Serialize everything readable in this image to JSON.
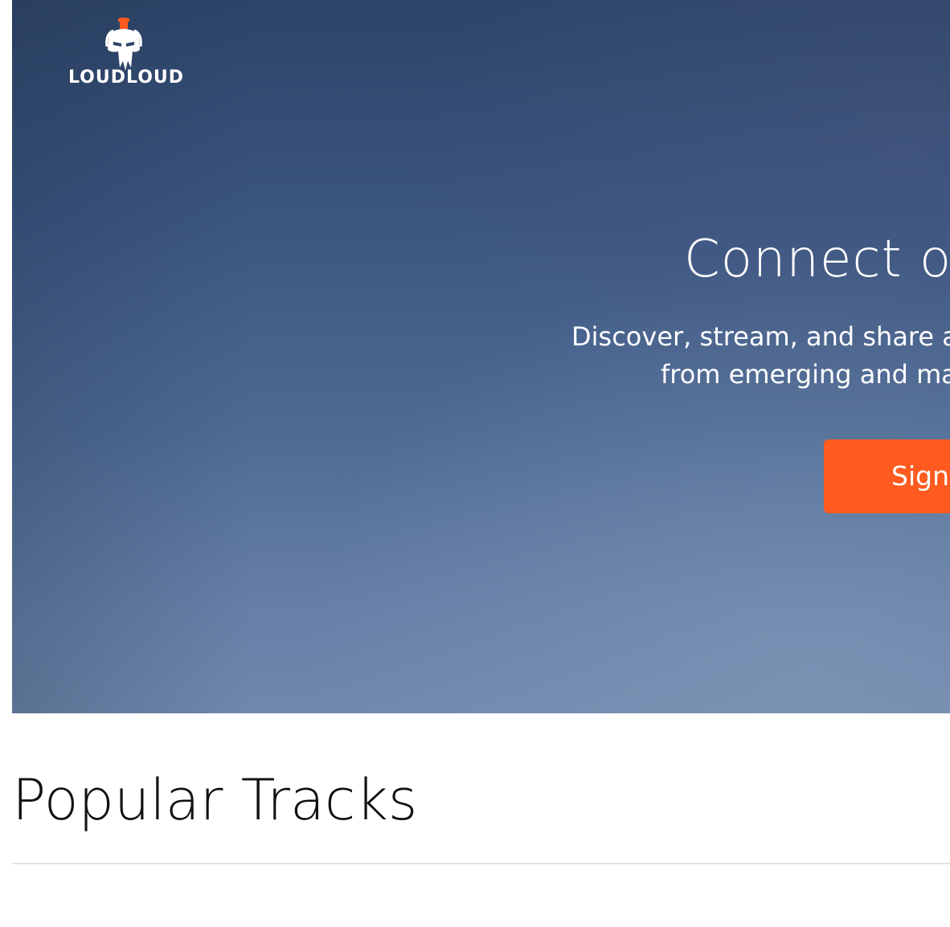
{
  "header": {
    "logo_text": "LOUDLOUD",
    "logo_icon": "spartan-helmet-icon"
  },
  "hero": {
    "title": "Connect o",
    "subtitle_line1": "Discover, stream, and share a",
    "subtitle_line2": "from emerging and ma",
    "cta_label": "Sign"
  },
  "section": {
    "title": "Popular Tracks"
  },
  "colors": {
    "accent": "#ff5a1f",
    "hero_top": "#2d4468",
    "hero_bottom": "#7088ad"
  }
}
